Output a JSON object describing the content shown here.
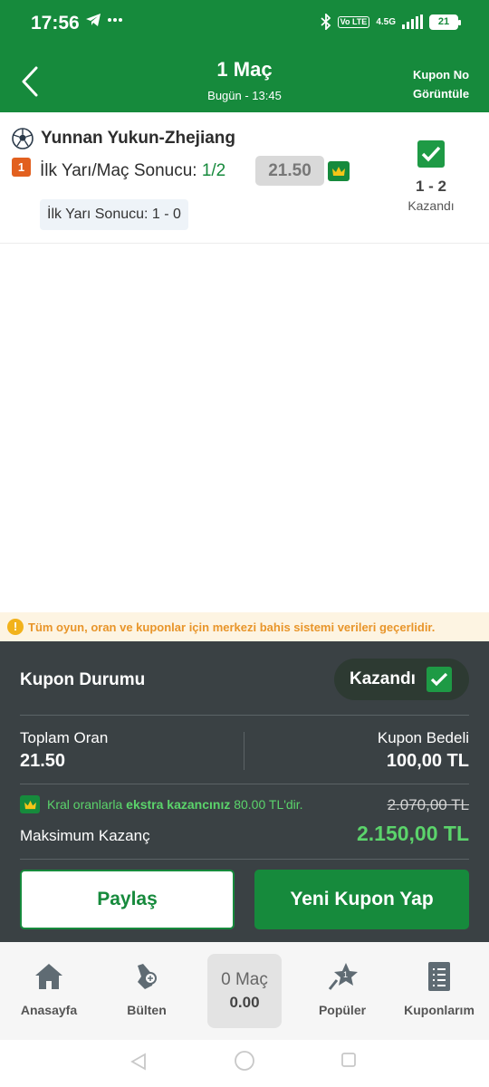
{
  "status_bar": {
    "time": "17:56",
    "left_icons": [
      "telegram-icon",
      "more-dots-icon"
    ],
    "volte": "Vo LTE",
    "network": "4.5G",
    "battery": "21"
  },
  "header": {
    "title": "1 Maç",
    "subtitle": "Bugün - 13:45",
    "kupon_no_label": "Kupon No Görüntüle"
  },
  "match": {
    "team": "Yunnan Yukun-Zhejiang",
    "index": "1",
    "bet_type": "İlk Yarı/Maç Sonucu:",
    "pick": "1/2",
    "odds": "21.50",
    "half_time_result": "İlk Yarı Sonucu: 1 - 0",
    "score": "1 - 2",
    "status": "Kazandı"
  },
  "info_banner": {
    "text": "Tüm oyun, oran ve kuponlar için merkezi bahis sistemi verileri geçerlidir."
  },
  "summary": {
    "kupon_durumu_label": "Kupon Durumu",
    "status_label": "Kazandı",
    "toplam_oran_label": "Toplam Oran",
    "toplam_oran_value": "21.50",
    "kupon_bedeli_label": "Kupon Bedeli",
    "kupon_bedeli_value": "100,00 TL",
    "king_prefix": "Kral oranlarla",
    "king_bold": "ekstra kazancınız",
    "king_suffix": "80.00 TL'dir.",
    "old_amount": "2.070,00 TL",
    "max_kazanc_label": "Maksimum Kazanç",
    "max_kazanc_value": "2.150,00 TL",
    "share_label": "Paylaş",
    "new_coupon_label": "Yeni Kupon Yap"
  },
  "bottom_nav": {
    "home": "Anasayfa",
    "bulletin": "Bülten",
    "cart_count": "0 Maç",
    "cart_total": "0.00",
    "popular": "Popüler",
    "coupons": "Kuponlarım"
  },
  "colors": {
    "brand_green": "#168a3c",
    "panel_dark": "#3a4144",
    "win_green": "#5bd46b",
    "warning_orange": "#e8952a",
    "badge_orange": "#e2601f"
  }
}
